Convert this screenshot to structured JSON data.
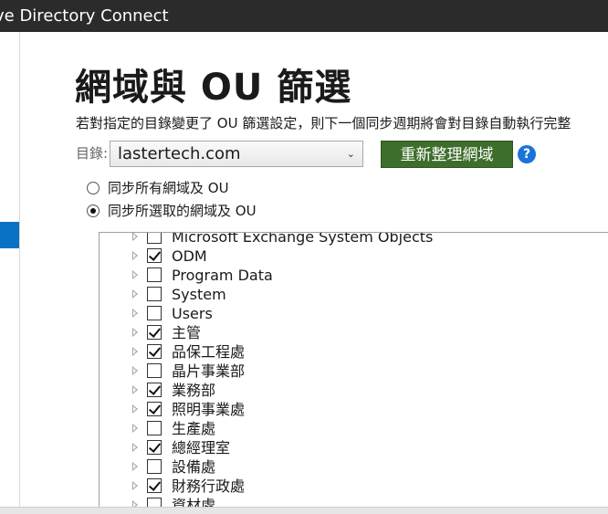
{
  "window": {
    "title": "ve Directory Connect"
  },
  "page": {
    "title": "網域與 OU 篩選",
    "description": "若對指定的目錄變更了 OU 篩選設定，則下一個同步週期將會對目錄自動執行完整"
  },
  "directory": {
    "label": "目錄:",
    "selected": "lastertech.com",
    "refresh_label": "重新整理網域",
    "help_symbol": "?"
  },
  "sync_options": [
    {
      "label": "同步所有網域及 OU",
      "selected": false
    },
    {
      "label": "同步所選取的網域及 OU",
      "selected": true
    }
  ],
  "tree": [
    {
      "label": "Microsoft Exchange System Objects",
      "checked": false
    },
    {
      "label": "ODM",
      "checked": true
    },
    {
      "label": "Program Data",
      "checked": false
    },
    {
      "label": "System",
      "checked": false
    },
    {
      "label": "Users",
      "checked": false
    },
    {
      "label": "主管",
      "checked": true
    },
    {
      "label": "品保工程處",
      "checked": true
    },
    {
      "label": "晶片事業部",
      "checked": false
    },
    {
      "label": "業務部",
      "checked": true
    },
    {
      "label": "照明事業處",
      "checked": true
    },
    {
      "label": "生產處",
      "checked": false
    },
    {
      "label": "總經理室",
      "checked": true
    },
    {
      "label": "設備處",
      "checked": false
    },
    {
      "label": "財務行政處",
      "checked": true
    },
    {
      "label": "資材處",
      "checked": false
    }
  ],
  "colors": {
    "titlebar": "#2b2b2b",
    "accent_selection": "#0a72c4",
    "refresh_button": "#3d6e2c",
    "help_icon": "#1a73d9"
  }
}
